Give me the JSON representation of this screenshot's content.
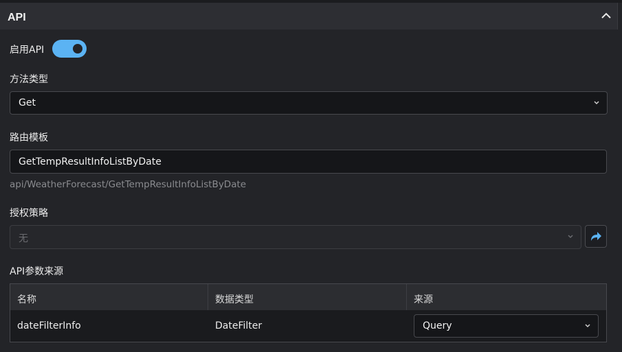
{
  "panel": {
    "title": "API"
  },
  "enable_api": {
    "label": "启用API",
    "enabled": true
  },
  "method": {
    "label": "方法类型",
    "value": "Get"
  },
  "route": {
    "label": "路由模板",
    "value": "GetTempResultInfoListByDate",
    "hint": "api/WeatherForecast/GetTempResultInfoListByDate"
  },
  "auth": {
    "label": "授权策略",
    "value": "无"
  },
  "params": {
    "label": "API参数来源",
    "columns": [
      "名称",
      "数据类型",
      "来源"
    ],
    "rows": [
      {
        "name": "dateFilterInfo",
        "type": "DateFilter",
        "source": "Query"
      }
    ]
  },
  "icons": {
    "collapse": "chevron-up-icon",
    "dropdown": "chevron-down-icon",
    "jump": "share-arrow-icon"
  },
  "colors": {
    "accent": "#5bb3f3",
    "background": "#232428"
  }
}
